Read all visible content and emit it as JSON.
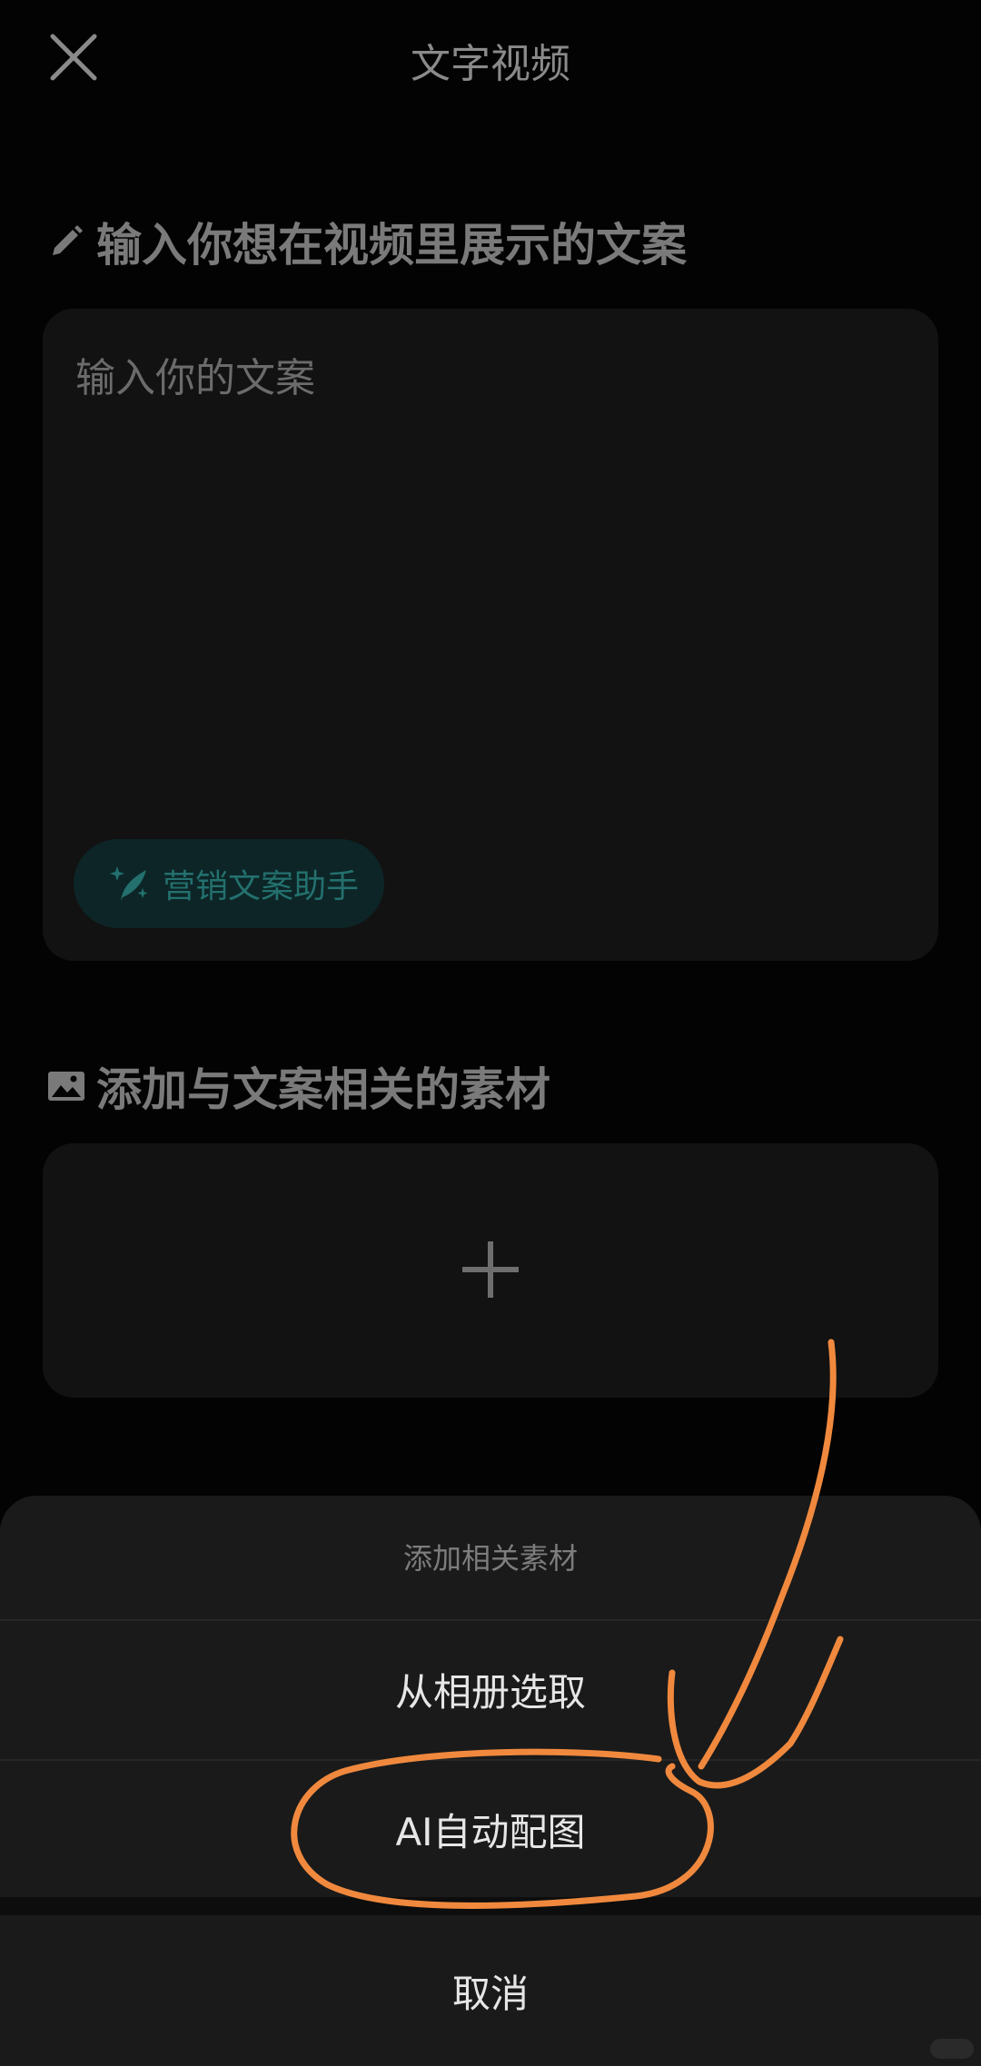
{
  "header": {
    "title": "文字视频",
    "close_icon": "close-icon"
  },
  "copy_section": {
    "heading": "输入你想在视频里展示的文案",
    "heading_icon": "pencil-icon",
    "input_placeholder": "输入你的文案",
    "assistant_label": "营销文案助手",
    "assistant_icon": "feather-sparkle-icon"
  },
  "media_section": {
    "heading": "添加与文案相关的素材",
    "heading_icon": "image-icon",
    "add_icon": "plus-icon"
  },
  "sheet": {
    "title": "添加相关素材",
    "options": [
      {
        "label": "从相册选取"
      },
      {
        "label": "AI自动配图"
      }
    ],
    "cancel_label": "取消"
  },
  "colors": {
    "background": "#030303",
    "card": "#121212",
    "sheet": "#1a1a1a",
    "accent_teal": "#23706e",
    "annotation_orange": "#f0893e"
  }
}
